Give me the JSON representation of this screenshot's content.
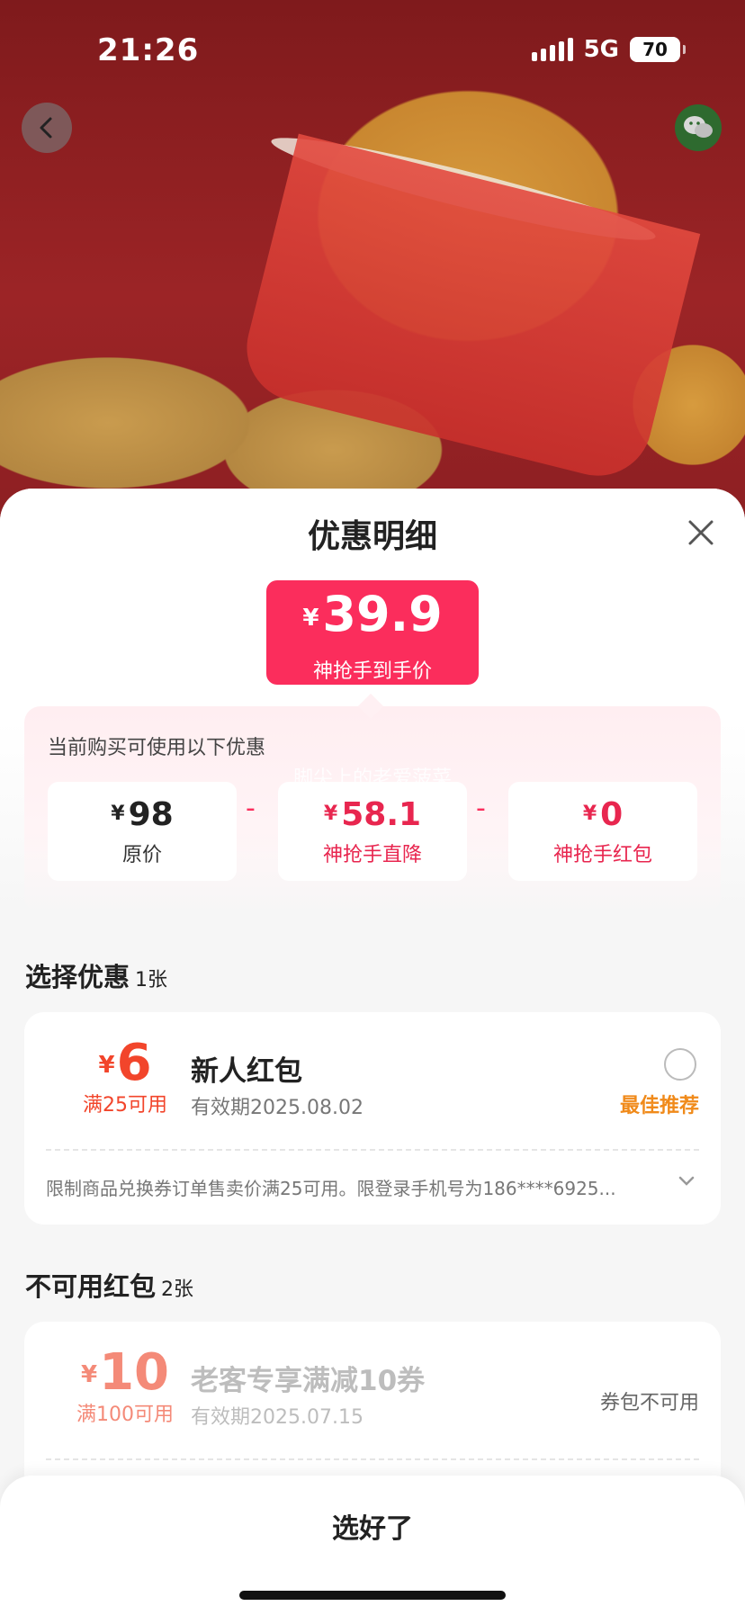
{
  "status_bar": {
    "time": "21:26",
    "network": "5G",
    "battery": "70"
  },
  "header": {
    "back_icon": "chevron-left-icon",
    "share_icon": "wechat-icon"
  },
  "sheet": {
    "title": "优惠明细",
    "close_icon": "close-icon",
    "final_price": {
      "currency": "¥",
      "value": "39.9",
      "label": "神抢手到手价"
    },
    "breakdown": {
      "caption": "当前购买可使用以下优惠",
      "watermark": "脚尖上的老爱菠菜",
      "items": [
        {
          "currency": "¥",
          "value": "98",
          "label": "原价"
        },
        {
          "currency": "¥",
          "value": "58.1",
          "label": "神抢手直降"
        },
        {
          "currency": "¥",
          "value": "0",
          "label": "神抢手红包"
        }
      ],
      "operator": "-"
    },
    "available": {
      "title": "选择优惠",
      "count": "1张",
      "coupon": {
        "currency": "¥",
        "value": "6",
        "condition": "满25可用",
        "name": "新人红包",
        "expiry": "有效期2025.08.02",
        "tag": "最佳推荐",
        "rules": "限制商品兑换券订单售卖价满25可用。限登录手机号为186****6925..."
      }
    },
    "unavailable": {
      "title": "不可用红包",
      "count": "2张",
      "coupon": {
        "currency": "¥",
        "value": "10",
        "condition": "满100可用",
        "name": "老客专享满减10券",
        "expiry": "有效期2025.07.15",
        "status": "券包不可用"
      }
    },
    "confirm_label": "选好了"
  },
  "colors": {
    "accent": "#fb2d5c",
    "orange": "#f08a1a",
    "coupon_red": "#f2452b"
  }
}
